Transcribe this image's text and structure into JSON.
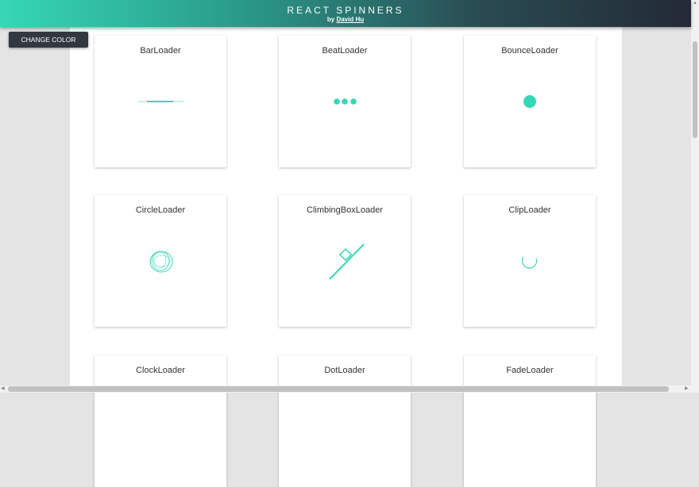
{
  "header": {
    "title": "REACT SPINNERS",
    "byline_prefix": "by",
    "author": "David Hu"
  },
  "toolbar": {
    "change_color_label": "CHANGE COLOR"
  },
  "colors": {
    "accent": "#36d7b7",
    "button": "#313840"
  },
  "loaders": [
    {
      "name": "BarLoader",
      "icon": "bar-loader-icon"
    },
    {
      "name": "BeatLoader",
      "icon": "beat-loader-icon"
    },
    {
      "name": "BounceLoader",
      "icon": "bounce-loader-icon"
    },
    {
      "name": "CircleLoader",
      "icon": "circle-loader-icon"
    },
    {
      "name": "ClimbingBoxLoader",
      "icon": "climbing-box-loader-icon"
    },
    {
      "name": "ClipLoader",
      "icon": "clip-loader-icon"
    },
    {
      "name": "ClockLoader",
      "icon": "clock-loader-icon"
    },
    {
      "name": "DotLoader",
      "icon": "dot-loader-icon"
    },
    {
      "name": "FadeLoader",
      "icon": "fade-loader-icon"
    }
  ]
}
